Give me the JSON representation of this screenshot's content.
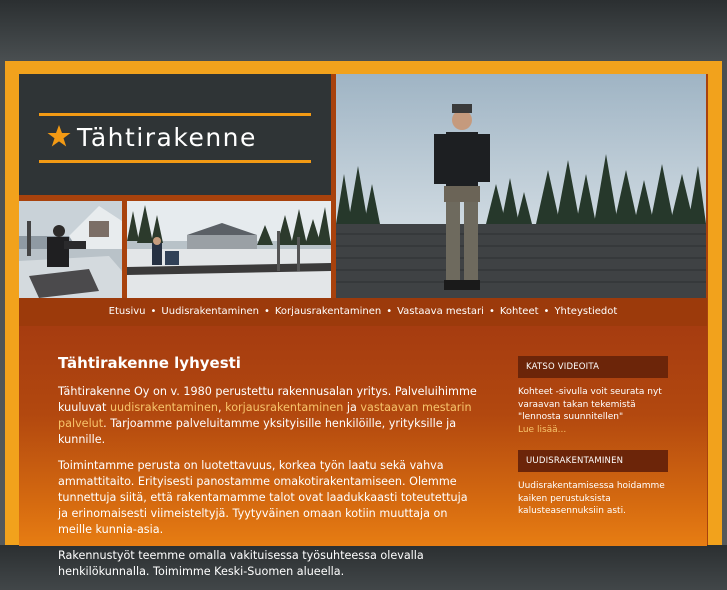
{
  "brand": {
    "name": "Tähtirakenne",
    "accent": "#f39a14",
    "logo_bg": "#2f3436"
  },
  "nav": {
    "items": [
      "Etusivu",
      "Uudisrakentaminen",
      "Korjausrakentaminen",
      "Vastaava mestari",
      "Kohteet",
      "Yhteystiedot"
    ],
    "separator": "•"
  },
  "main": {
    "title": "Tähtirakenne lyhyesti",
    "p1_before": "Tähtirakenne Oy on v. 1980 perustettu rakennusalan yritys. Palveluihimme kuuluvat ",
    "p1_link1": "uudisrakentaminen",
    "p1_sep1": ", ",
    "p1_link2": "korjausrakentaminen",
    "p1_sep2": " ja ",
    "p1_link3": "vastaavan mestarin palvelut",
    "p1_after": ". Tarjoamme palveluitamme yksityisille henkilöille, yrityksille ja kunnille.",
    "p2": "Toimintamme perusta on luotettavuus, korkea työn laatu sekä vahva ammattitaito. Erityisesti panostamme omakotirakentamiseen. Olemme tunnettuja siitä, että rakentamamme talot ovat laadukkaasti toteutettuja ja erinomaisesti viimeisteltyjä. Tyytyväinen omaan kotiin muuttaja on meille kunnia-asia.",
    "p3": "Rakennustyöt teemme omalla vakituisessa työsuhteessa olevalla henkilökunnalla. Toimimme Keski-Suomen alueella."
  },
  "sidebar": {
    "videos": {
      "heading": "KATSO VIDEOITA",
      "text": "Kohteet -sivulla voit seurata nyt varaavan takan tekemistä \"lennosta suunnitellen\"",
      "more": "Lue lisää..."
    },
    "new_building": {
      "heading": "UUDISRAKENTAMINEN",
      "text": "Uudisrakentamisessa hoidamme kaiken perustuksista kalusteasennuksiin asti."
    }
  }
}
